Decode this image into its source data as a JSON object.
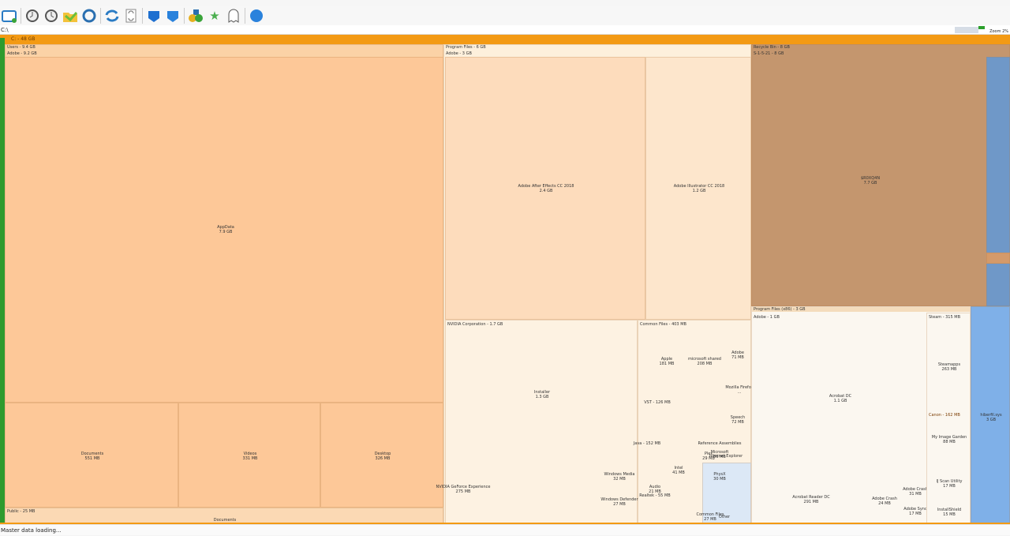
{
  "toolbar": {
    "icons": [
      "scan-drive-icon",
      "clock-back-icon",
      "clock-forward-icon",
      "folder-icon",
      "refresh-network-icon",
      "refresh-icon",
      "document-refresh-icon",
      "cube-blue-icon",
      "cube-blue-2-icon",
      "shapes-icon",
      "star-icon",
      "ghost-icon",
      "globe-icon"
    ]
  },
  "address": {
    "value": "C:\\"
  },
  "zoom_label": "Zoom 2%",
  "root": {
    "label": "C: - 48 GB"
  },
  "users": {
    "header": "Users - 9.4 GB",
    "sub": "Adobe - 9.2 GB",
    "appdata": "AppData\n7.9 GB",
    "documents": "Documents\n551 MB",
    "videos": "Videos\n331 MB",
    "desktop": "Desktop\n326 MB",
    "public": "Public - 25 MB",
    "public_docs": "Documents"
  },
  "program_files": {
    "header": "Program Files - 6 GB",
    "adobe": "Adobe - 3 GB",
    "after_effects": "Adobe After Effects CC 2018\n2.4 GB",
    "illustrator": "Adobe Illustrator CC 2018\n1.2 GB",
    "nvidia": "NVIDIA Corporation - 1.7 GB",
    "common": "Common Files - 403 MB",
    "installer": "Installer\n1.3 GB",
    "nvidia_sub": "NVIDIA GeForce Experience\n275 MB",
    "small": [
      {
        "t": "Apple\n181 MB"
      },
      {
        "t": "microsoft shared\n208 MB"
      },
      {
        "t": "Adobe\n71 MB"
      },
      {
        "t": "VST - 126 MB"
      },
      {
        "t": "Mozilla Firefox\n…"
      },
      {
        "t": "Speech\n72 MB"
      },
      {
        "t": "Java - 152 MB"
      },
      {
        "t": "Reference Assemblies"
      },
      {
        "t": "Microsoft\n56 MB"
      },
      {
        "t": "PhysX\n30 MB"
      },
      {
        "t": "Audio\n21 MB"
      },
      {
        "t": "Realtek - 55 MB"
      },
      {
        "t": "Windows Defender\n27 MB"
      },
      {
        "t": "Intel\n41 MB"
      },
      {
        "t": "Windows Media\n32 MB"
      },
      {
        "t": "Plex\n29 MB"
      },
      {
        "t": "Common Files\n27 MB"
      },
      {
        "t": "Internet Explorer"
      },
      {
        "t": "Other"
      }
    ]
  },
  "recycle": {
    "header": "Recycle Bin - 8 GB",
    "sub": "S-1-5-21 - 8 GB",
    "item": "$R0XQ4N\n7.7 GB"
  },
  "pf86": {
    "header": "Program Files (x86) - 3 GB",
    "adobe": "Adobe - 1 GB",
    "reader": "Acrobat DC\n1.1 GB",
    "reader2": "Acrobat Reader DC\n291 MB",
    "steam": "Steam - 315 MB",
    "steamapps": "Steamapps\n263 MB",
    "canon": "Canon - 162 MB",
    "image": "My Image Garden\n88 MB",
    "crash": "Adobe Crash\n24 MB",
    "crash2": "Adobe Crash\n31 MB",
    "sync": "Adobe Sync\n17 MB",
    "util": "IJ Scan Utility\n17 MB",
    "common": "InstallShield\n15 MB",
    "blue": "hiberfil.sys\n3 GB"
  },
  "status": "Master data loading..."
}
